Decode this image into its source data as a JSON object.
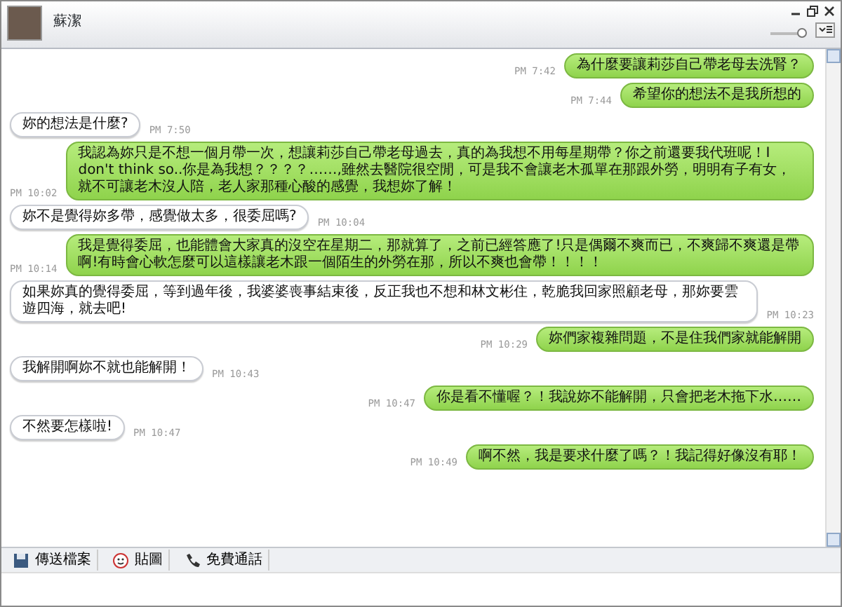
{
  "header": {
    "contact_name": "蘇潔",
    "zoom_slider": {
      "level": 0.9
    }
  },
  "messages": [
    {
      "kind": "sent",
      "text": "為什麼要讓莉莎自己帶老母去洗腎？",
      "time": "PM 7:42"
    },
    {
      "kind": "sent",
      "text": "希望你的想法不是我所想的",
      "time": "PM 7:44"
    },
    {
      "kind": "received",
      "text": "妳的想法是什麼?",
      "time": "PM 7:50"
    },
    {
      "kind": "sent",
      "text": "我認為妳只是不想一個月帶一次，想讓莉莎自己帶老母過去，真的為我想不用每星期帶？你之前還要我代班呢！I don't think so..你是為我想？？？？……,雖然去醫院很空閒，可是我不會讓老木孤單在那跟外勞，明明有子有女，就不可讓老木沒人陪，老人家那種心酸的感覺，我想妳了解！",
      "time": "PM 10:02"
    },
    {
      "kind": "received",
      "text": "妳不是覺得妳多帶，感覺做太多，很委屈嗎?",
      "time": "PM 10:04"
    },
    {
      "kind": "sent",
      "text": "我是覺得委屈，也能體會大家真的沒空在星期二，那就算了，之前已經答應了!只是偶爾不爽而已，不爽歸不爽還是帶啊!有時會心軟怎麼可以這樣讓老木跟一個陌生的外勞在那，所以不爽也會帶！！！！",
      "time": "PM 10:14"
    },
    {
      "kind": "received",
      "text": "如果妳真的覺得委屈，等到過年後，我婆婆喪事結束後，反正我也不想和林文彬住，乾脆我回家照顧老母，那妳要雲遊四海，就去吧!",
      "time": "PM 10:23"
    },
    {
      "kind": "sent",
      "text": "妳們家複雜問題，不是住我們家就能解開",
      "time": "PM 10:29"
    },
    {
      "kind": "received",
      "text": "我解開啊妳不就也能解開！",
      "time": "PM 10:43"
    },
    {
      "kind": "sent",
      "text": "你是看不懂喔？！我說妳不能解開，只會把老木拖下水……",
      "time": "PM 10:47"
    },
    {
      "kind": "received",
      "text": "不然要怎樣啦!",
      "time": "PM 10:47"
    },
    {
      "kind": "sent",
      "text": "啊不然，我是要求什麼了嗎？！我記得好像沒有耶！",
      "time": "PM 10:49"
    }
  ],
  "toolbar": [
    {
      "kind": "file",
      "label": "傳送檔案"
    },
    {
      "kind": "sticker",
      "label": "貼圖"
    },
    {
      "kind": "call",
      "label": "免費通話"
    }
  ]
}
